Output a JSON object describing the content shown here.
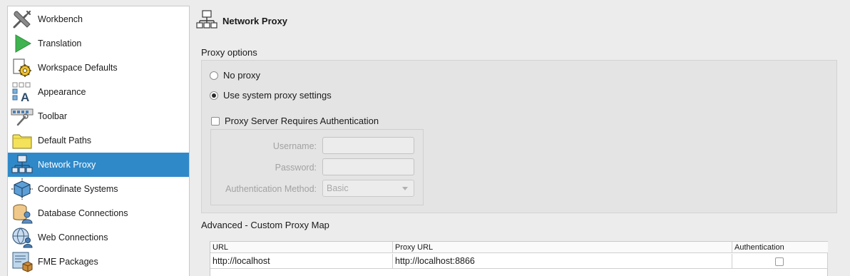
{
  "sidebar": {
    "items": [
      {
        "label": "Workbench",
        "icon": "workbench-tools-icon",
        "selected": false
      },
      {
        "label": "Translation",
        "icon": "play-triangle-icon",
        "selected": false
      },
      {
        "label": "Workspace Defaults",
        "icon": "workspace-gear-icon",
        "selected": false
      },
      {
        "label": "Appearance",
        "icon": "appearance-font-icon",
        "selected": false
      },
      {
        "label": "Toolbar",
        "icon": "toolbar-icon",
        "selected": false
      },
      {
        "label": "Default Paths",
        "icon": "folder-icon",
        "selected": false
      },
      {
        "label": "Network Proxy",
        "icon": "network-icon",
        "selected": true
      },
      {
        "label": "Coordinate Systems",
        "icon": "coordinate-cube-icon",
        "selected": false
      },
      {
        "label": "Database Connections",
        "icon": "database-user-icon",
        "selected": false
      },
      {
        "label": "Web Connections",
        "icon": "globe-user-icon",
        "selected": false
      },
      {
        "label": "FME Packages",
        "icon": "package-icon",
        "selected": false
      }
    ]
  },
  "page": {
    "title": "Network Proxy",
    "icon": "network-icon"
  },
  "proxy_options": {
    "section_label": "Proxy options",
    "no_proxy_label": "No proxy",
    "no_proxy_selected": false,
    "system_proxy_label": "Use system proxy settings",
    "system_proxy_selected": true,
    "auth_required_label": "Proxy Server Requires Authentication",
    "auth_required_checked": false,
    "username_label": "Username:",
    "username_value": "",
    "password_label": "Password:",
    "password_value": "",
    "auth_method_label": "Authentication Method:",
    "auth_method_value": "Basic"
  },
  "advanced": {
    "section_label": "Advanced - Custom Proxy Map",
    "columns": [
      "URL",
      "Proxy URL",
      "Authentication"
    ],
    "rows": [
      {
        "url": "http://localhost",
        "proxy_url": "http://localhost:8866",
        "authentication": false
      }
    ]
  },
  "colors": {
    "selection": "#2f89c9",
    "background": "#ececec",
    "group_background": "#e4e4e4"
  }
}
